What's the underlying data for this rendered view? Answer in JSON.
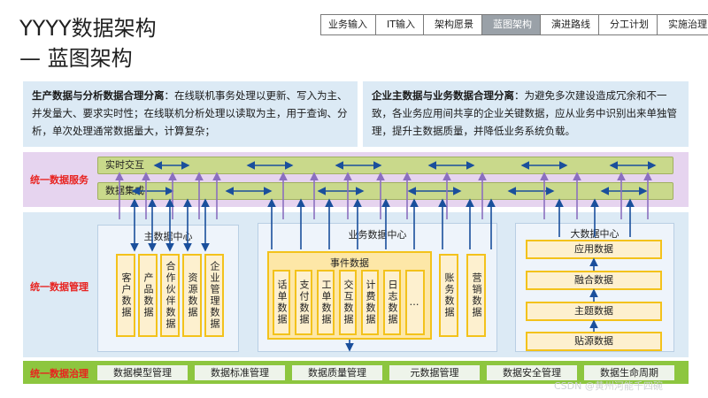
{
  "title": {
    "line1": "YYYY数据架构",
    "line2": "— 蓝图架构"
  },
  "breadcrumb": {
    "items": [
      "业务输入",
      "IT输入",
      "架构愿景",
      "蓝图架构",
      "演进路线",
      "分工计划",
      "实施治理"
    ],
    "active_index": 3
  },
  "principles": {
    "left_head": "生产数据与分析数据合理分离",
    "left_body": "：在线联机事务处理以更新、写入为主、并发量大、要求实时性；在线联机分析处理以读取为主，用于查询、分析，单次处理通常数据量大，计算复杂；",
    "right_head": "企业主数据与业务数据合理分离",
    "right_body": "：为避免多次建设造成冗余和不一致，各业务应用间共享的企业关键数据，应从业务中识别出来单独管理，提升主数据质量，并降低业务系统负载。"
  },
  "service": {
    "label": "统一数据服务",
    "bar1": "实时交互",
    "bar2": "数据集成"
  },
  "management": {
    "label": "统一数据管理",
    "master": {
      "title": "主数据中心",
      "items": [
        "客户数据",
        "产品数据",
        "合作伙伴数据",
        "资源数据",
        "企业管理数据"
      ]
    },
    "business": {
      "title": "业务数据中心",
      "events_title": "事件数据",
      "events": [
        "话单数据",
        "支付数据",
        "工单数据",
        "交互数据",
        "计费数据",
        "日志数据",
        "…"
      ],
      "others": [
        "账务数据",
        "营销数据"
      ]
    },
    "bigdata": {
      "title": "大数据中心",
      "layers": [
        "应用数据",
        "融合数据",
        "主题数据",
        "贴源数据"
      ]
    }
  },
  "governance": {
    "label": "统一数据治理",
    "items": [
      "数据模型管理",
      "数据标准管理",
      "数据质量管理",
      "元数据管理",
      "数据安全管理",
      "数据生命周期"
    ]
  },
  "watermark": "CSDN @黄州河能千四碗",
  "colors": {
    "accent_red": "#e8221f",
    "governance_green": "#8dc63f",
    "service_purple": "#e6d4ef",
    "management_blue": "#dceaf5",
    "item_yellow": "#f3c21b",
    "arrow_blue": "#1a4f9c",
    "arrow_purple": "#8b6fc0"
  }
}
